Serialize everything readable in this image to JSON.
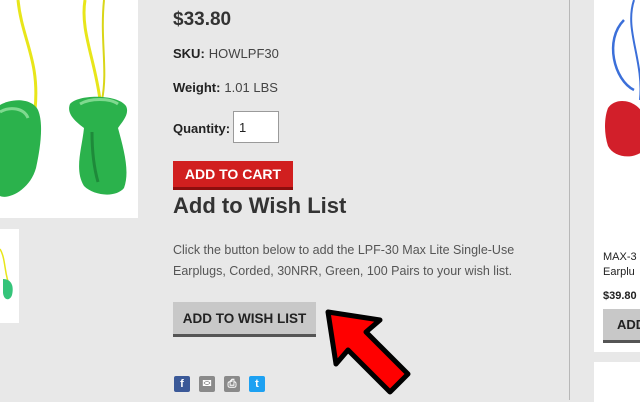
{
  "product": {
    "price": "$33.80",
    "sku_label": "SKU:",
    "sku_value": "HOWLPF30",
    "weight_label": "Weight:",
    "weight_value": "1.01 LBS",
    "quantity_label": "Quantity:",
    "quantity_value": "1",
    "add_to_cart_label": "ADD TO CART"
  },
  "wishlist": {
    "heading": "Add to Wish List",
    "description": "Click the button below to add the LPF-30 Max Lite Single-Use Earplugs, Corded, 30NRR, Green, 100 Pairs to your wish list.",
    "button_label": "ADD TO WISH LIST"
  },
  "share": {
    "icons": [
      "facebook-icon",
      "email-icon",
      "print-icon",
      "twitter-icon"
    ],
    "facebook_glyph": "f",
    "email_glyph": "✉",
    "print_glyph": "⎙",
    "twitter_glyph": "t"
  },
  "related": {
    "title_line1": "MAX-3",
    "title_line2": "Earplu",
    "price": "$39.80",
    "button_label": "ADD"
  },
  "colors": {
    "cart_button": "#d11f1f",
    "wish_button": "#c8c8c8",
    "arrow": "#ff0000",
    "earplug_green": "#2bb24c",
    "cord_yellow": "#e8e61a"
  }
}
